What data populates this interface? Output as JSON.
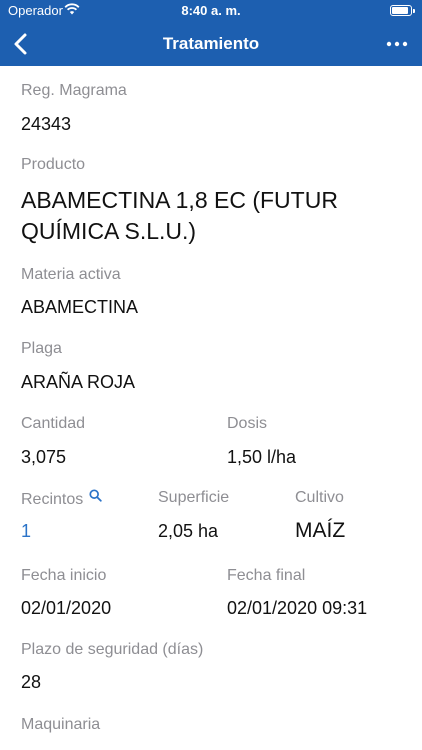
{
  "status_bar": {
    "carrier": "Operador",
    "time": "8:40 a. m."
  },
  "nav": {
    "title": "Tratamiento",
    "back_icon": "chevron-left-icon",
    "more_icon": "more-horizontal-icon"
  },
  "fields": {
    "reg_label": "Reg. Magrama",
    "reg_value": "24343",
    "producto_label": "Producto",
    "producto_value_line1": "ABAMECTINA 1,8 EC (FUTUR",
    "producto_value_line2": "QUÍMICA S.L.U.)",
    "materia_label": "Materia activa",
    "materia_value": "ABAMECTINA",
    "plaga_label": "Plaga",
    "plaga_value": "ARAÑA ROJA",
    "cantidad_label": "Cantidad",
    "cantidad_value": "3,075",
    "dosis_label": "Dosis",
    "dosis_value": "1,50 l/ha",
    "recintos_label": "Recintos",
    "recintos_value": "1",
    "superficie_label": "Superficie",
    "superficie_value": "2,05 ha",
    "cultivo_label": "Cultivo",
    "cultivo_value": "MAÍZ",
    "fecha_inicio_label": "Fecha inicio",
    "fecha_inicio_value": "02/01/2020",
    "fecha_final_label": "Fecha final",
    "fecha_final_value": "02/01/2020 09:31",
    "plazo_label": "Plazo de seguridad (días)",
    "plazo_value": "28",
    "maquinaria_label": "Maquinaria"
  },
  "colors": {
    "header_bg": "#1d5fb0",
    "label": "#8e8e93",
    "link": "#2b73c8"
  }
}
